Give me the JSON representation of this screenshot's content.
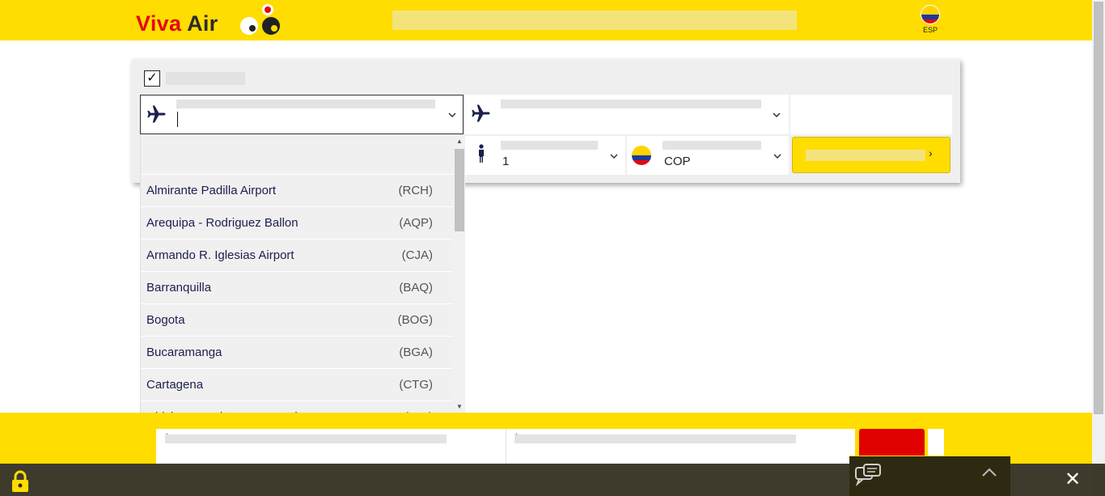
{
  "header": {
    "brand_first": "Viva",
    "brand_second": "Air",
    "language": "ESP"
  },
  "booking": {
    "round_trip_checked": true,
    "check_mark": "✓",
    "passengers_value": "1",
    "currency_value": "COP"
  },
  "airports": [
    {
      "name": "Almirante Padilla Airport",
      "code": "(RCH)"
    },
    {
      "name": "Arequipa - Rodriguez Ballon",
      "code": "(AQP)"
    },
    {
      "name": "Armando R. Iglesias Airport",
      "code": "(CJA)"
    },
    {
      "name": "Barranquilla",
      "code": "(BAQ)"
    },
    {
      "name": "Bogota",
      "code": "(BOG)"
    },
    {
      "name": "Bucaramanga",
      "code": "(BGA)"
    },
    {
      "name": "Cartagena",
      "code": "(CTG)"
    },
    {
      "name": "Chiclayo - Quinones Gonzalez",
      "code": "(CIX)"
    }
  ],
  "bottom": {
    "required_mark": "*",
    "close_symbol": "✕"
  },
  "colors": {
    "brand_yellow": "#ffdd00",
    "brand_red": "#e30613",
    "navy": "#1b1f4d"
  },
  "icons": [
    "plane-icon",
    "person-icon",
    "colombia-flag-icon",
    "chevron-down-icon",
    "lock-icon",
    "chat-icon",
    "close-icon"
  ]
}
